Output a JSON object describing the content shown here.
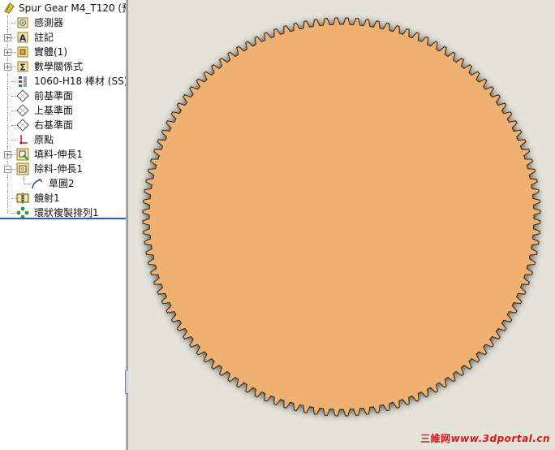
{
  "feature_tree": {
    "root": {
      "label": "Spur Gear M4_T120  (預",
      "icon": "part-icon"
    },
    "items": [
      {
        "label": "感測器",
        "icon": "sensors-icon",
        "expandable": false
      },
      {
        "label": "註記",
        "icon": "annotations-icon",
        "expandable": true
      },
      {
        "label": "實體(1)",
        "icon": "solid-bodies-icon",
        "expandable": true
      },
      {
        "label": "數學關係式",
        "icon": "equations-icon",
        "expandable": true
      },
      {
        "label": "1060-H18 棒材 (SS)",
        "icon": "material-icon",
        "expandable": false
      },
      {
        "label": "前基準面",
        "icon": "plane-icon",
        "expandable": false
      },
      {
        "label": "上基準面",
        "icon": "plane-icon",
        "expandable": false
      },
      {
        "label": "右基準面",
        "icon": "plane-icon",
        "expandable": false
      },
      {
        "label": "原點",
        "icon": "origin-icon",
        "expandable": false
      },
      {
        "label": "填料-伸長1",
        "icon": "boss-extrude-icon",
        "expandable": true
      },
      {
        "label": "除料-伸長1",
        "icon": "cut-extrude-icon",
        "expandable": true,
        "expanded": true
      },
      {
        "label": "草圖2",
        "icon": "sketch-icon",
        "expandable": false,
        "child": true
      },
      {
        "label": "鏡射1",
        "icon": "mirror-icon",
        "expandable": false
      },
      {
        "label": "環狀複製排列1",
        "icon": "circular-pattern-icon",
        "expandable": false
      }
    ]
  },
  "viewport": {
    "model": "spur-gear",
    "teeth": 120,
    "gear_color": "#f0b070",
    "edge_color": "#2a2218",
    "background_color": "#e4e3da"
  },
  "watermark": {
    "cn": "三維网",
    "url": "www.3dportal.cn"
  }
}
